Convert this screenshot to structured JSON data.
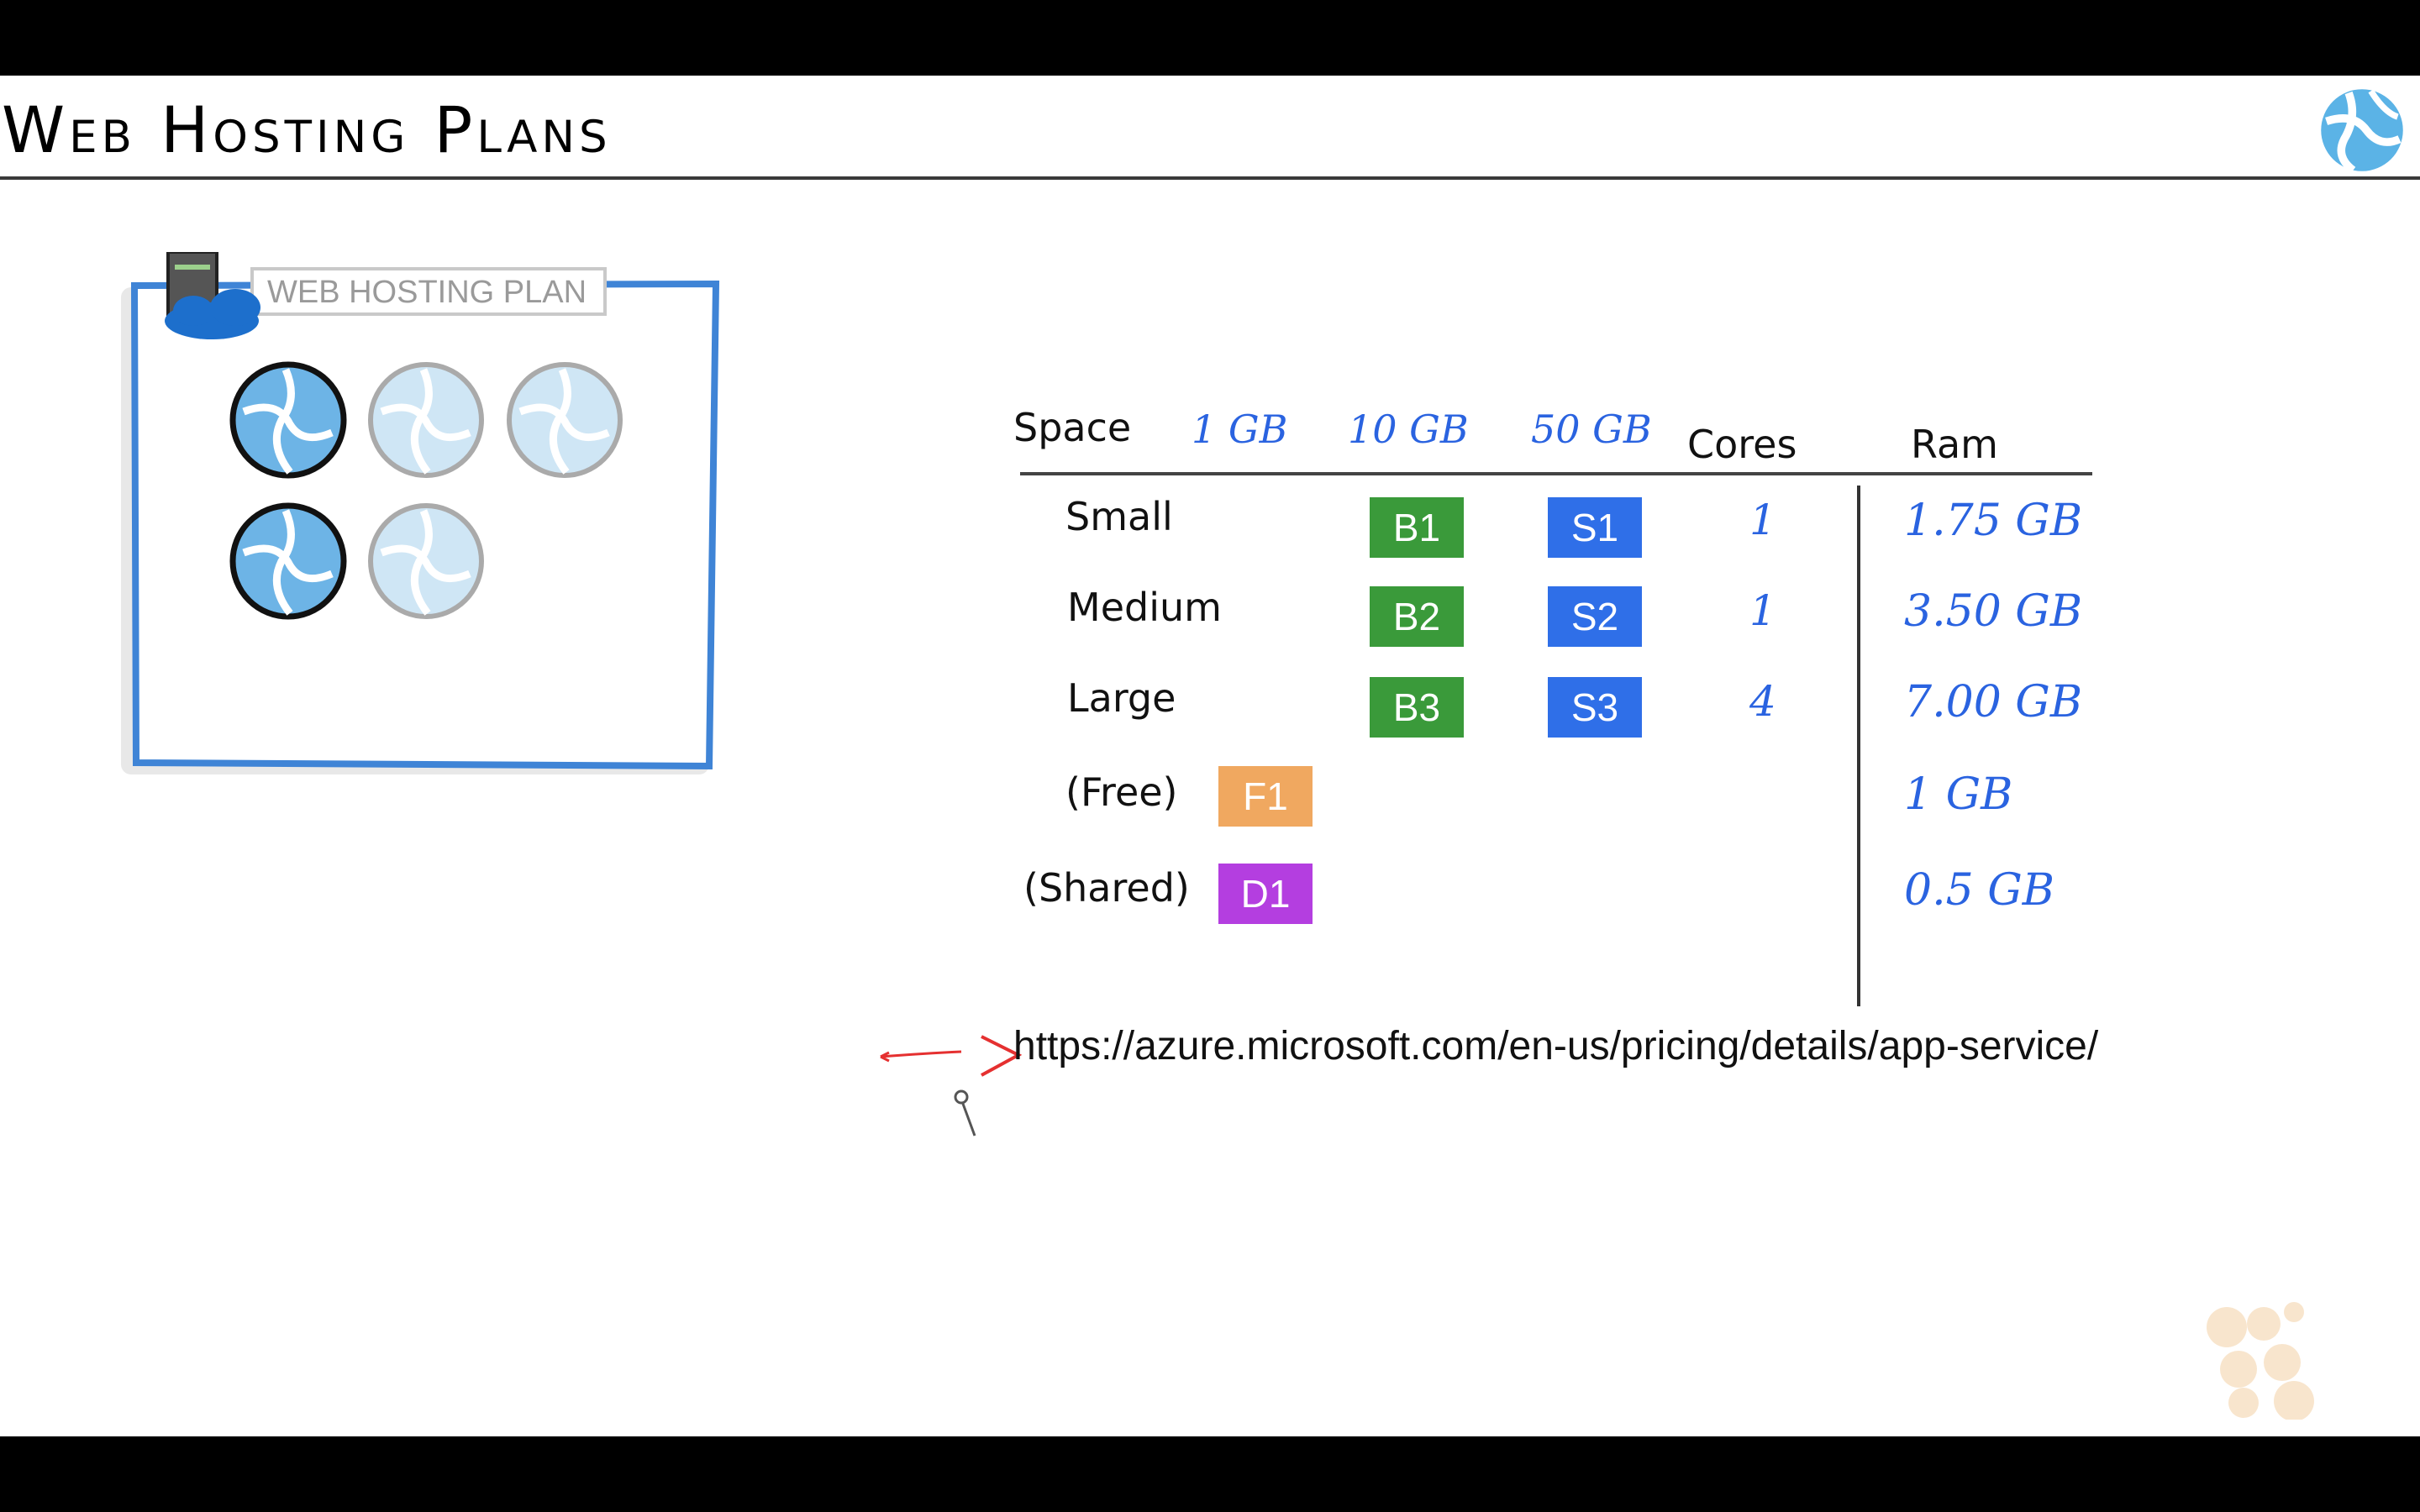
{
  "slide": {
    "title": "Web Hosting Plans",
    "diagram_label": "WEB HOSTING PLAN"
  },
  "table": {
    "headers": {
      "space": "Space",
      "space_1": "1 GB",
      "space_10": "10 GB",
      "space_50": "50 GB",
      "cores": "Cores",
      "ram": "Ram"
    },
    "rows": [
      {
        "label": "Small",
        "basic": "B1",
        "standard": "S1",
        "cores": "1",
        "ram": "1.75 GB"
      },
      {
        "label": "Medium",
        "basic": "B2",
        "standard": "S2",
        "cores": "1",
        "ram": "3.50 GB"
      },
      {
        "label": "Large",
        "basic": "B3",
        "standard": "S3",
        "cores": "4",
        "ram": "7.00 GB"
      },
      {
        "label": "(Free)",
        "tier": "F1",
        "ram": "1 GB"
      },
      {
        "label": "(Shared)",
        "tier": "D1",
        "ram": "0.5 GB"
      }
    ]
  },
  "url": "https://azure.microsoft.com/en-us/pricing/details/app-service/",
  "colors": {
    "basic": "#3a9a3a",
    "standard": "#2f6fe8",
    "free": "#f0a860",
    "shared": "#b43ee0",
    "handwriting": "#2a63e0",
    "plan_border": "#3f84d6"
  }
}
